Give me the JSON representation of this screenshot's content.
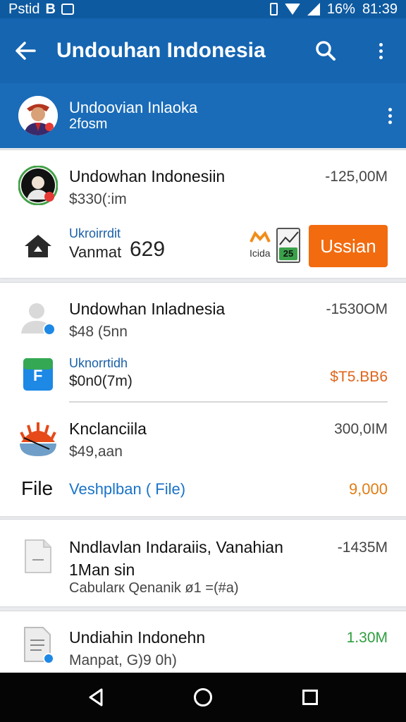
{
  "status_bar": {
    "left_text": "Pstid",
    "battery": "16%",
    "time": "81:39"
  },
  "app_bar": {
    "title": "Undouhan Indonesia"
  },
  "account": {
    "name": "Undoovian Inlaoka",
    "subtitle": "2fosm"
  },
  "items": [
    {
      "title": "Undowhan Indonesiin",
      "subtitle": "$330(:im",
      "amount": "-125,00M",
      "footer_small": "Ukroirrdit",
      "footer_label": "Vanmat",
      "footer_value": "629",
      "mini_label": "Icida",
      "mini_badge": "25",
      "button_label": "Ussian",
      "colors": {
        "button": "#f26b0f",
        "mini_badge": "#3aa14a"
      }
    },
    {
      "title": "Undowhan Inladnesia",
      "subtitle": "$48 (5nn",
      "amount": "-1530OM",
      "sub_small": "Uknorrtidh",
      "sub_value": "$0n0(7m)",
      "sub_amount": "$T5.BB6",
      "sub_icon_letter": "F",
      "colors": {
        "sub_amount": "#e0641a"
      }
    },
    {
      "title": "Knclanciila",
      "subtitle": "$49,aan",
      "amount": "300,0IM",
      "footer_label": "File",
      "footer_link": "Veshplban ( File)",
      "footer_amount": "9,000",
      "colors": {
        "footer_link": "#1a73c8",
        "footer_amount": "#e07d16"
      }
    },
    {
      "title": "Nndlavlan Indaraiis, Vanahian",
      "title_line2": "1Man sin",
      "subtitle": "Cabularк Qenanik ø1 =(#a)",
      "amount": "-1435M"
    },
    {
      "title": "Undiahin Indonehn",
      "subtitle": "Manpat, G)9 0h)",
      "amount": "1.30M",
      "colors": {
        "amount": "#2e9e3e"
      }
    }
  ]
}
